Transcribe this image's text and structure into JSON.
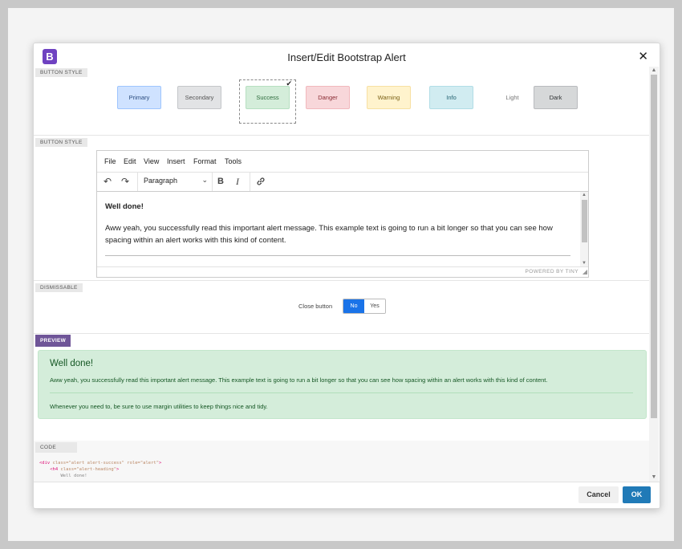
{
  "dialog": {
    "logo_letter": "B",
    "title": "Insert/Edit Bootstrap Alert",
    "close_symbol": "✕"
  },
  "sections": {
    "style_label": "BUTTON STYLE",
    "content_label": "BUTTON STYLE",
    "dismissable_label": "DISMISSABLE",
    "preview_label": "PREVIEW",
    "code_label": "CODE"
  },
  "styles": [
    {
      "label": "Primary",
      "bg": "#cfe2ff",
      "border": "#9ec5fe",
      "color": "#2b4c7e"
    },
    {
      "label": "Secondary",
      "bg": "#e2e3e5",
      "border": "#c4c6c9",
      "color": "#555"
    },
    {
      "label": "Success",
      "bg": "#d4edda",
      "border": "#b6dfc1",
      "color": "#2d6b3c",
      "selected": true
    },
    {
      "label": "Danger",
      "bg": "#f8d7da",
      "border": "#f1b8bd",
      "color": "#8a2b33"
    },
    {
      "label": "Warning",
      "bg": "#fff3cd",
      "border": "#f7e0a2",
      "color": "#7a6015"
    },
    {
      "label": "Info",
      "bg": "#d1ecf1",
      "border": "#b1dde6",
      "color": "#236270"
    },
    {
      "label": "Light",
      "bg": "#ffffff",
      "border": "#ffffff",
      "color": "#777"
    },
    {
      "label": "Dark",
      "bg": "#d6d8d9",
      "border": "#b9bbbe",
      "color": "#2e3133"
    }
  ],
  "editor": {
    "menu": [
      "File",
      "Edit",
      "View",
      "Insert",
      "Format",
      "Tools"
    ],
    "block_format": "Paragraph",
    "bold_label": "B",
    "italic_label": "I",
    "heading": "Well done!",
    "body": "Aww yeah, you successfully read this important alert message. This example text is going to run a bit longer so that you can see how spacing within an alert works with this kind of content.",
    "powered_by": "POWERED BY TINY"
  },
  "dismiss": {
    "label": "Close button",
    "no": "No",
    "yes": "Yes",
    "selected": "No"
  },
  "preview": {
    "heading": "Well done!",
    "text": "Aww yeah, you successfully read this important alert message. This example text is going to run a bit longer so that you can see how spacing within an alert works with this kind of content.",
    "text2": "Whenever you need to, be sure to use margin utilities to keep things nice and tidy."
  },
  "code": {
    "line1_open": "<div ",
    "line1_attr": "class=\"alert alert-success\" role=\"alert\"",
    "line1_close": ">",
    "line2_open": "    <h4 ",
    "line2_attr": "class=\"alert-heading\"",
    "line2_close": ">",
    "line3": "        Well done!"
  },
  "footer": {
    "cancel": "Cancel",
    "ok": "OK"
  }
}
